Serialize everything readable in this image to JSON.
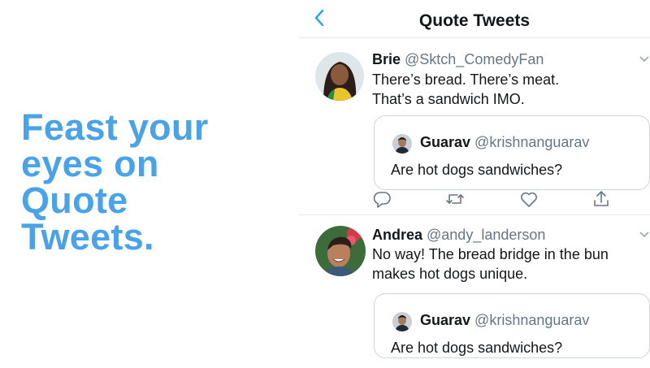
{
  "promo": {
    "lines": [
      "Feast your",
      "eyes on",
      "Quote",
      "Tweets."
    ],
    "color": "#4aa3e8"
  },
  "nav": {
    "back_icon": "chevron-left-icon",
    "title": "Quote Tweets"
  },
  "tweets": [
    {
      "name": "Brie",
      "handle": "@Sktch_ComedyFan",
      "text_lines": [
        "There’s bread. There’s meat.",
        "That’s a sandwich IMO."
      ],
      "quote": {
        "name": "Guarav",
        "handle": "@krishnanguarav",
        "text": "Are hot dogs sandwiches?"
      },
      "actions": [
        "reply-icon",
        "retweet-icon",
        "like-icon",
        "share-icon"
      ]
    },
    {
      "name": "Andrea",
      "handle": "@andy_landerson",
      "text_lines": [
        "No way! The bread bridge in the bun",
        "makes hot dogs unique."
      ],
      "quote": {
        "name": "Guarav",
        "handle": "@krishnanguarav",
        "text": "Are hot dogs sandwiches?"
      }
    }
  ],
  "colors": {
    "accent": "#1da1f2",
    "text": "#14171a",
    "secondary": "#657786",
    "border": "#ccd6dd"
  }
}
